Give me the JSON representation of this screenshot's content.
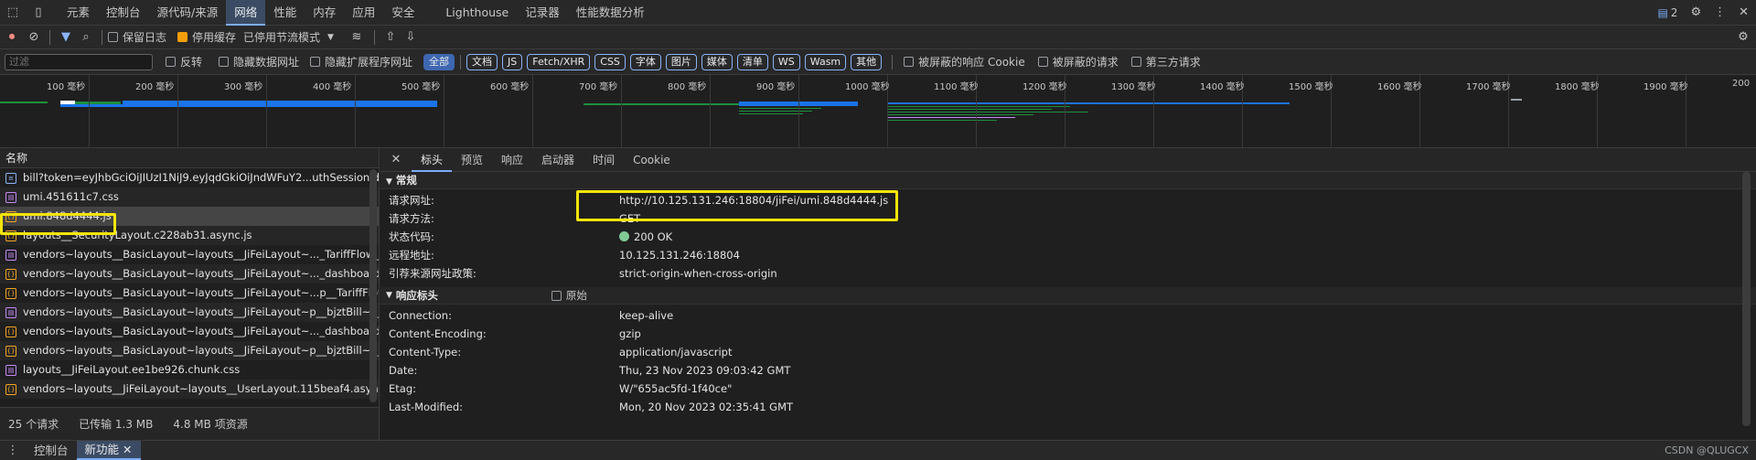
{
  "top_tabs": [
    "元素",
    "控制台",
    "源代码/来源",
    "网络",
    "性能",
    "内存",
    "应用",
    "安全",
    "Lighthouse",
    "记录器",
    "性能数据分析"
  ],
  "active_tab": "网络",
  "issues_count": "2",
  "toolbar": {
    "preserve_log": "保留日志",
    "disable_cache": "停用缓存",
    "throttling": "已停用节流模式"
  },
  "filter_bar": {
    "placeholder": "过滤",
    "invert": "反转",
    "hide_data_urls": "隐藏数据网址",
    "hide_extension_urls": "隐藏扩展程序网址",
    "types": [
      "全部",
      "文档",
      "JS",
      "Fetch/XHR",
      "CSS",
      "字体",
      "图片",
      "媒体",
      "清单",
      "WS",
      "Wasm",
      "其他"
    ],
    "blocked_cookies": "被屏蔽的响应 Cookie",
    "blocked_requests": "被屏蔽的请求",
    "third_party": "第三方请求"
  },
  "timeline_ticks": [
    "100 毫秒",
    "200 毫秒",
    "300 毫秒",
    "400 毫秒",
    "500 毫秒",
    "600 毫秒",
    "700 毫秒",
    "800 毫秒",
    "900 毫秒",
    "1000 毫秒",
    "1100 毫秒",
    "1200 毫秒",
    "1300 毫秒",
    "1400 毫秒",
    "1500 毫秒",
    "1600 毫秒",
    "1700 毫秒",
    "1800 毫秒",
    "1900 毫秒",
    "200"
  ],
  "request_list": {
    "header": "名称",
    "items": [
      {
        "name": "bill?token=eyJhbGciOiJIUzI1NiJ9.eyJqdGkiOiJndWFuY2...uthSessionId...",
        "type": "doc"
      },
      {
        "name": "umi.451611c7.css",
        "type": "css"
      },
      {
        "name": "umi.848d4444.js",
        "type": "js"
      },
      {
        "name": "layouts__SecurityLayout.c228ab31.async.js",
        "type": "js"
      },
      {
        "name": "vendors~layouts__BasicLayout~layouts__JiFeiLayout~..._TariffFlow_e...",
        "type": "css"
      },
      {
        "name": "vendors~layouts__BasicLayout~layouts__JiFeiLayout~..._dashboard__l...",
        "type": "js"
      },
      {
        "name": "vendors~layouts__BasicLayout~layouts__JiFeiLayout~...p__TariffFlow_...",
        "type": "js"
      },
      {
        "name": "vendors~layouts__BasicLayout~layouts__JiFeiLayout~p__bjztBill~p__f...",
        "type": "css"
      },
      {
        "name": "vendors~layouts__BasicLayout~layouts__JiFeiLayout~..._dashboard_...",
        "type": "js"
      },
      {
        "name": "vendors~layouts__BasicLayout~layouts__JiFeiLayout~p__bjztBill~p__f...",
        "type": "js"
      },
      {
        "name": "layouts__JiFeiLayout.ee1be926.chunk.css",
        "type": "css"
      },
      {
        "name": "vendors~layouts__JiFeiLayout~layouts__UserLayout.115beaf4.async.js",
        "type": "js"
      }
    ]
  },
  "status_bar": {
    "requests": "25 个请求",
    "transferred": "已传输 1.3 MB",
    "resources": "4.8 MB 项资源"
  },
  "detail_tabs": [
    "标头",
    "预览",
    "响应",
    "启动器",
    "时间",
    "Cookie"
  ],
  "general": {
    "title": "常规",
    "rows": [
      {
        "k": "请求网址:",
        "v": "http://10.125.131.246:18804/jiFei/umi.848d4444.js"
      },
      {
        "k": "请求方法:",
        "v": "GET"
      },
      {
        "k": "状态代码:",
        "v": "200 OK"
      },
      {
        "k": "远程地址:",
        "v": "10.125.131.246:18804"
      },
      {
        "k": "引荐来源网址政策:",
        "v": "strict-origin-when-cross-origin"
      }
    ]
  },
  "response_headers": {
    "title": "响应标头",
    "raw": "原始",
    "rows": [
      {
        "k": "Connection:",
        "v": "keep-alive"
      },
      {
        "k": "Content-Encoding:",
        "v": "gzip"
      },
      {
        "k": "Content-Type:",
        "v": "application/javascript"
      },
      {
        "k": "Date:",
        "v": "Thu, 23 Nov 2023 09:03:42 GMT"
      },
      {
        "k": "Etag:",
        "v": "W/\"655ac5fd-1f40ce\""
      },
      {
        "k": "Last-Modified:",
        "v": "Mon, 20 Nov 2023 02:35:41 GMT"
      }
    ]
  },
  "bottom_tabs": [
    "控制台",
    "新功能"
  ],
  "watermark": "CSDN @QLUGCX",
  "colors": {
    "highlight": "#f5e50a",
    "status_ok": "#81c995",
    "accent": "#7cacf8"
  }
}
